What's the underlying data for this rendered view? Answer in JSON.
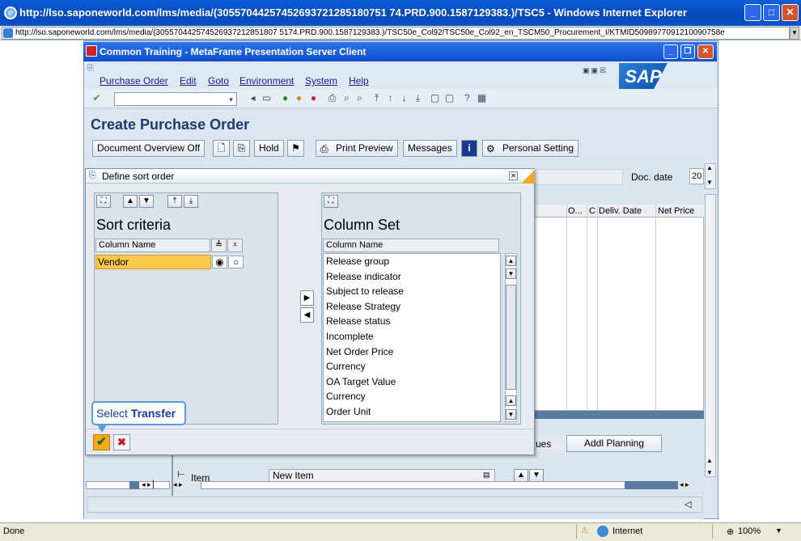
{
  "ie": {
    "title": "http://lso.saponeworld.com/lms/media/(30557044257452693721285180751 74.PRD.900.1587129383.)/TSC5 - Windows Internet Explorer",
    "address": "http://lso.saponeworld.com/lms/media/(305570442574526937212851807 5174.PRD.900.1587129383.)/TSC50e_Col92/TSC50e_Col92_en_TSCM50_Procurement_I/KTMID509897709121009075​8e",
    "status_left": "Done",
    "zone": "Internet",
    "zoom": "100%"
  },
  "metaframe": {
    "title": "Common Training - MetaFrame Presentation Server Client"
  },
  "menu": [
    "Purchase Order",
    "Edit",
    "Goto",
    "Environment",
    "System",
    "Help"
  ],
  "page": {
    "title": "Create Purchase Order"
  },
  "app_toolbar": {
    "doc_overview": "Document Overview Off",
    "hold": "Hold",
    "print_preview": "Print Preview",
    "messages": "Messages",
    "personal_setting": "Personal Setting"
  },
  "header_fields": {
    "doc_date_label": "Doc. date",
    "doc_date_value": "20"
  },
  "grid": {
    "columns": [
      "O...",
      "C",
      "Deliv. Date",
      "Net Price"
    ]
  },
  "bottom": {
    "tab_partial": "ues",
    "addl_planning": "Addl Planning",
    "item_label": "Item",
    "item_select": "New Item"
  },
  "dialog": {
    "title": "Define sort order",
    "left_title": "Sort criteria",
    "left_col_header": "Column Name",
    "sort_rows": [
      {
        "name": "Vendor",
        "ascending": true,
        "descending": false
      }
    ],
    "right_title": "Column Set",
    "right_col_header": "Column Name",
    "column_set": [
      "Release group",
      "Release indicator",
      "Subject to release",
      "Release Strategy",
      "Release status",
      "Incomplete",
      "Net Order Price",
      "Currency",
      "OA Target Value",
      "Currency",
      "Order Unit"
    ]
  },
  "tooltip": {
    "prefix": "Select ",
    "action": "Transfer"
  },
  "colors": {
    "ie_titlebar": "#0747b8",
    "sap_title": "#1d3a6e",
    "selected_row": "#f8c94a",
    "tooltip_border": "#5a9ad8"
  }
}
